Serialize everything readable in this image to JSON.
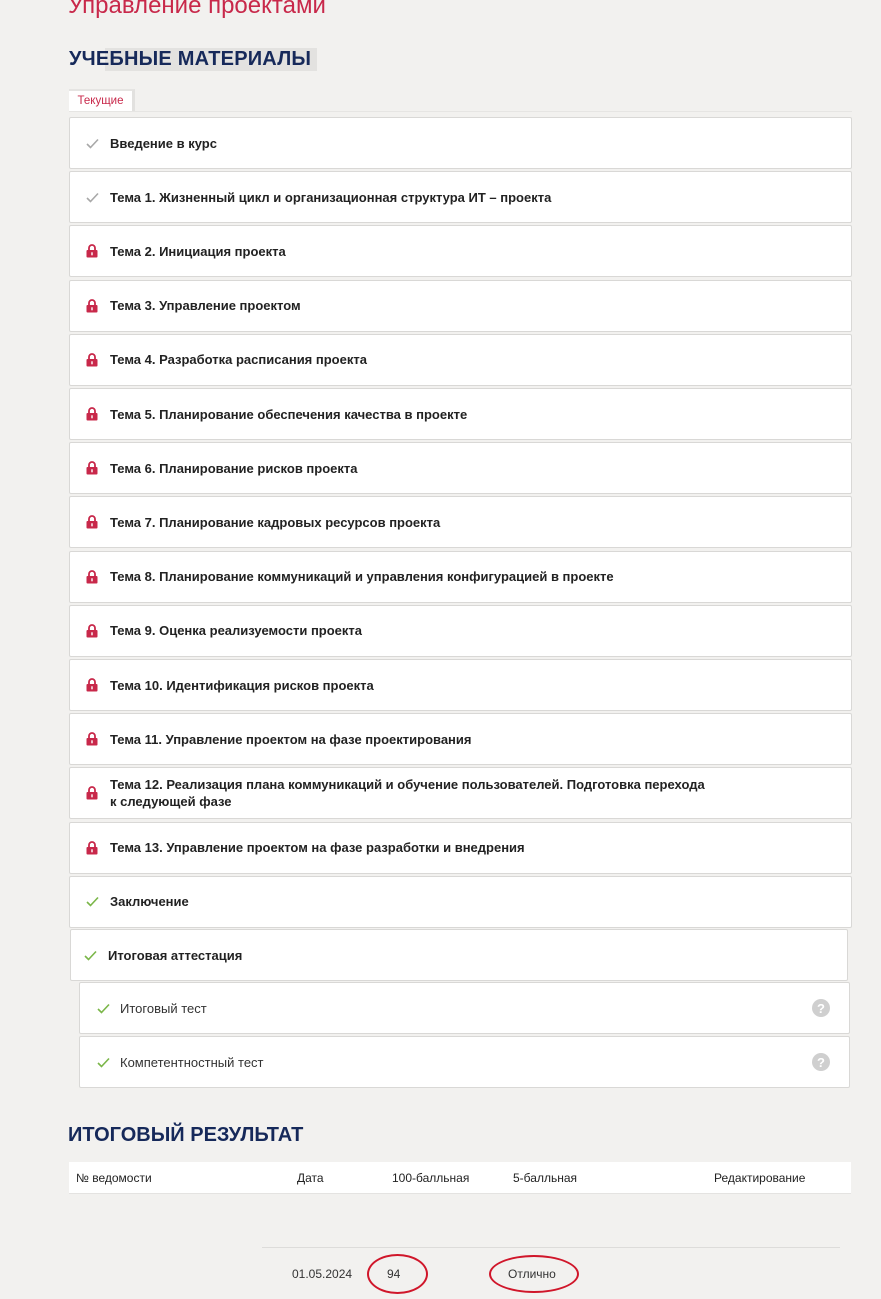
{
  "page_title": "Управление проектами",
  "materials": {
    "title": "УЧЕБНЫЕ МАТЕРИАЛЫ",
    "tab_current": "Текущие",
    "items": [
      {
        "label": "Введение в курс",
        "status": "done-gray"
      },
      {
        "label": "Тема 1. Жизненный цикл и организационная структура ИТ – проекта",
        "status": "done-gray"
      },
      {
        "label": "Тема 2. Инициация проекта",
        "status": "locked"
      },
      {
        "label": "Тема 3. Управление проектом",
        "status": "locked"
      },
      {
        "label": "Тема 4. Разработка расписания проекта",
        "status": "locked"
      },
      {
        "label": "Тема 5. Планирование обеспечения качества в проекте",
        "status": "locked"
      },
      {
        "label": "Тема 6. Планирование рисков проекта",
        "status": "locked"
      },
      {
        "label": "Тема 7. Планирование кадровых ресурсов проекта",
        "status": "locked"
      },
      {
        "label": "Тема 8. Планирование коммуникаций и управления конфигурацией в проекте",
        "status": "locked"
      },
      {
        "label": "Тема 9. Оценка реализуемости проекта",
        "status": "locked"
      },
      {
        "label": "Тема 10. Идентификация рисков проекта",
        "status": "locked"
      },
      {
        "label": "Тема 11. Управление проектом на фазе проектирования",
        "status": "locked"
      },
      {
        "label": "Тема 12. Реализация плана коммуникаций и обучение пользователей. Подготовка перехода к следующей фазе",
        "status": "locked"
      },
      {
        "label": "Тема 13. Управление проектом на фазе разработки и внедрения",
        "status": "locked"
      },
      {
        "label": "Заключение",
        "status": "done-green"
      }
    ],
    "final": {
      "label": "Итоговая аттестация",
      "status": "done-green",
      "tests": [
        {
          "label": "Итоговый тест",
          "help": "?"
        },
        {
          "label": "Компетентностный тест",
          "help": "?"
        }
      ]
    }
  },
  "result": {
    "title": "ИТОГОВЫЙ РЕЗУЛЬТАТ",
    "columns": [
      "№ ведомости",
      "Дата",
      "100-балльная",
      "5-балльная",
      "Редактирование"
    ],
    "row": {
      "number": "",
      "date": "01.05.2024",
      "score100": "94",
      "score5": "Отлично",
      "edit": ""
    }
  },
  "colors": {
    "accent": "#c8284a",
    "heading": "#16295a",
    "check_green": "#7ab648",
    "check_gray": "#a8a8a8",
    "annotation_red": "#d0162a"
  }
}
